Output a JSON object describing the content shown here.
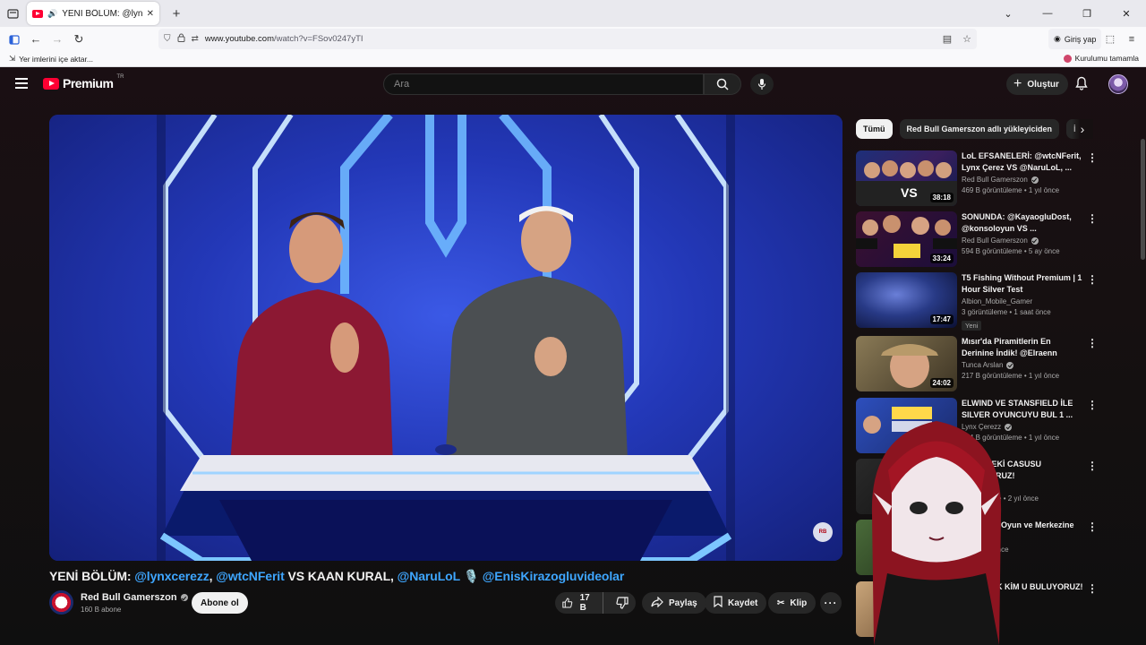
{
  "browser": {
    "tab_title": "YENİ BÖLÜM: @lynxcerezz,",
    "url_prefix": "www.youtube.com",
    "url_path": "/watch?v=FSov0247yTI",
    "login_label": "Giriş yap",
    "bookmarks_import": "Yer imlerini içe aktar...",
    "setup_label": "Kurulumu tamamla"
  },
  "youtube": {
    "logo_word": "Premium",
    "logo_country": "TR",
    "search_placeholder": "Ara",
    "create_label": "Oluştur"
  },
  "video": {
    "title_parts": {
      "p1": "YENİ BÖLÜM: ",
      "m1": "@lynxcerezz",
      "c1": ", ",
      "m2": "@wtcNFerit",
      "p2": " VS KAAN KURAL, ",
      "m3": "@NaruLoL",
      "p3": " 🎙️ ",
      "m4": "@EnisKirazogluvideolar"
    },
    "channel": "Red Bull Gamerszon",
    "subscribers": "160 B abone",
    "subscribe_label": "Abone ol",
    "likes": "17 B",
    "share_label": "Paylaş",
    "save_label": "Kaydet",
    "clip_label": "Klip"
  },
  "sidebar": {
    "chips": [
      "Tümü",
      "Red Bull Gamerszon adlı yükleyiciden",
      "İ"
    ],
    "items": [
      {
        "title": "LoL EFSANELERİ: @wtcNFerit, Lynx Çerez VS @NaruLoL, ...",
        "channel": "Red Bull Gamerszon",
        "verified": true,
        "meta": "469 B görüntüleme • 1 yıl önce",
        "duration": "38:18"
      },
      {
        "title": "SONUNDA: @KayaogluDost, @konsoloyun VS ...",
        "channel": "Red Bull Gamerszon",
        "verified": true,
        "meta": "594 B görüntüleme • 5 ay önce",
        "duration": "33:24"
      },
      {
        "title": "T5 Fishing Without Premium | 1 Hour Silver Test",
        "channel": "Albion_Mobile_Gamer",
        "verified": false,
        "meta": "3 görüntüleme • 1 saat önce",
        "duration": "17:47",
        "badge": "Yeni"
      },
      {
        "title": "Mısır'da Piramitlerin En Derinine İndik! @Elraenn @Batuhan ...",
        "channel": "Tunca Arslan",
        "verified": true,
        "meta": "217 B görüntüleme • 1 yıl önce",
        "duration": "24:02"
      },
      {
        "title": "ELWIND VE STANSFIELD İLE SILVER OYUNCUYU BUL 1 ...",
        "channel": "Lynx Çerezz",
        "verified": true,
        "meta": "174 B görüntüleme • 1 yıl önce",
        "duration": ""
      },
      {
        "title": "İÇİMİZDEKİ CASUSU BULUYORUZ!",
        "channel": "Player",
        "verified": true,
        "meta": "görüntüleme • 2 yıl önce",
        "duration": ""
      },
      {
        "title": "En Büyük Oyun ve Merkezine Gittim! 🇯🇵",
        "channel": "",
        "verified": false,
        "meta": "me • 1 yıl önce",
        "duration": ""
      },
      {
        "title": "SORARAK KİM U BULUYORUZ!",
        "channel": "",
        "verified": false,
        "meta": "",
        "duration": ""
      }
    ]
  },
  "colors": {
    "accent": "#ff0033",
    "mention": "#3ea6ff",
    "yt_bg": "#0f0f0f"
  }
}
